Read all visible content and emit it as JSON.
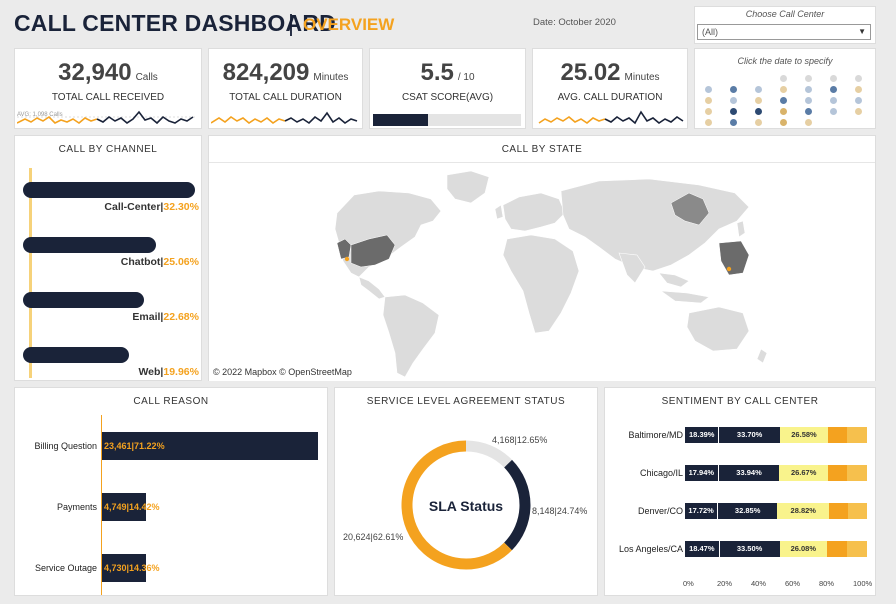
{
  "header": {
    "title": "CALL CENTER DASHBOARD",
    "separator": "|",
    "subtitle": "OVERVIEW",
    "date": "Date: October 2020"
  },
  "filter": {
    "label": "Choose Call Center",
    "value": "(All)"
  },
  "kpis": {
    "total_calls": {
      "value": "32,940",
      "unit": "Calls",
      "label": "TOTAL CALL RECEIVED",
      "avg_note": "AVG: 1,098 Calls"
    },
    "total_duration": {
      "value": "824,209",
      "unit": "Minutes",
      "label": "TOTAL CALL DURATION"
    },
    "csat": {
      "value": "5.5",
      "unit": "/ 10",
      "label": "CSAT SCORE(AVG)",
      "fill_fraction": 0.37
    },
    "avg_duration": {
      "value": "25.02",
      "unit": "Minutes",
      "label": "AVG. CALL DURATION"
    }
  },
  "date_picker": {
    "hint": "Click the date to specify"
  },
  "colors": {
    "navy": "#1a2339",
    "orange": "#f4a21f",
    "light_orange": "#f6d27a",
    "yellow": "#f9f38c",
    "gray": "#e4e4e4"
  },
  "channel": {
    "title": "CALL BY CHANNEL",
    "items": [
      {
        "name": "Call-Center",
        "pct": "32.30%",
        "value": 32.3
      },
      {
        "name": "Chatbot",
        "pct": "25.06%",
        "value": 25.06
      },
      {
        "name": "Email",
        "pct": "22.68%",
        "value": 22.68
      },
      {
        "name": "Web",
        "pct": "19.96%",
        "value": 19.96
      }
    ]
  },
  "state_map": {
    "title": "CALL BY STATE",
    "attribution": "© 2022 Mapbox  © OpenStreetMap"
  },
  "reason": {
    "title": "CALL REASON",
    "items": [
      {
        "name": "Billing Question",
        "label": "23,461|71.22%",
        "value": 23461
      },
      {
        "name": "Payments",
        "label": "4,749|14.42%",
        "value": 4749
      },
      {
        "name": "Service Outage",
        "label": "4,730|14.36%",
        "value": 4730
      }
    ]
  },
  "sla": {
    "title": "SERVICE LEVEL AGREEMENT STATUS",
    "center_label": "SLA Status",
    "segments": [
      {
        "label": "4,168|12.65%",
        "value": 12.65,
        "color": "#e4e4e4"
      },
      {
        "label": "8,148|24.74%",
        "value": 24.74,
        "color": "#1a2339"
      },
      {
        "label": "20,624|62.61%",
        "value": 62.61,
        "color": "#f4a21f"
      }
    ]
  },
  "sentiment": {
    "title": "SENTIMENT BY CALL CENTER",
    "axis_ticks": [
      "0%",
      "20%",
      "40%",
      "60%",
      "80%",
      "100%"
    ],
    "rows": [
      {
        "city": "Baltimore/MD",
        "labels": [
          "18.39%",
          "33.70%",
          "26.58%"
        ],
        "values": [
          18.39,
          33.7,
          26.58,
          10.5,
          10.83
        ]
      },
      {
        "city": "Chicago/IL",
        "labels": [
          "17.94%",
          "33.94%",
          "26.67%"
        ],
        "values": [
          17.94,
          33.94,
          26.67,
          10.7,
          10.75
        ]
      },
      {
        "city": "Denver/CO",
        "labels": [
          "17.72%",
          "32.85%",
          "28.82%"
        ],
        "values": [
          17.72,
          32.85,
          28.82,
          10.3,
          10.31
        ]
      },
      {
        "city": "Los Angeles/CA",
        "labels": [
          "18.47%",
          "33.50%",
          "26.08%"
        ],
        "values": [
          18.47,
          33.5,
          26.08,
          11.0,
          10.95
        ]
      }
    ]
  }
}
